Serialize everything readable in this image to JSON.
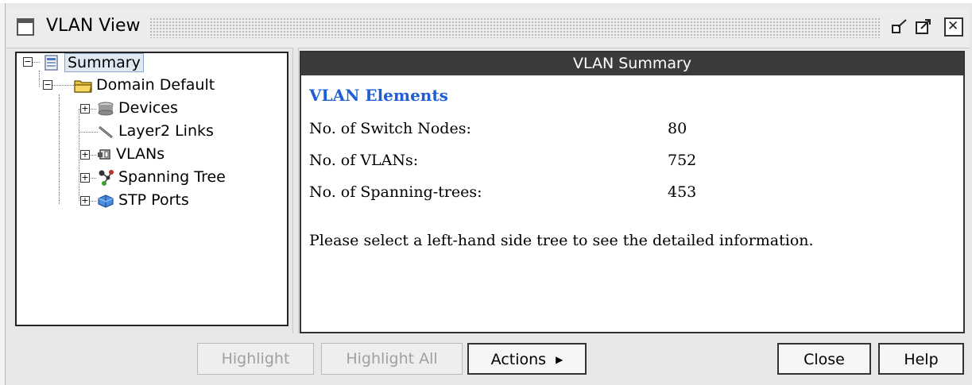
{
  "window": {
    "title": "VLAN View"
  },
  "tree": {
    "items": [
      {
        "label": "Summary",
        "icon": "summary-icon"
      },
      {
        "label": "Domain Default",
        "icon": "folder-icon"
      },
      {
        "label": "Devices",
        "icon": "device-icon"
      },
      {
        "label": "Layer2 Links",
        "icon": "link-icon"
      },
      {
        "label": "VLANs",
        "icon": "vlan-icon"
      },
      {
        "label": "Spanning Tree",
        "icon": "spanning-tree-icon"
      },
      {
        "label": "STP Ports",
        "icon": "stp-port-icon"
      }
    ]
  },
  "summary": {
    "header": "VLAN Summary",
    "heading": "VLAN Elements",
    "stats": [
      {
        "label": "No. of Switch Nodes:",
        "value": "80"
      },
      {
        "label": "No. of VLANs:",
        "value": "752"
      },
      {
        "label": "No. of Spanning-trees:",
        "value": "453"
      }
    ],
    "note": "Please select a left-hand side tree to see the detailed information."
  },
  "buttons": {
    "highlight": "Highlight",
    "highlight_all": "Highlight All",
    "actions": "Actions",
    "close": "Close",
    "help": "Help"
  },
  "colors": {
    "heading_blue": "#1f5fd6",
    "panel_header_bg": "#3b3b3b",
    "window_bg": "#e7e7e7"
  }
}
